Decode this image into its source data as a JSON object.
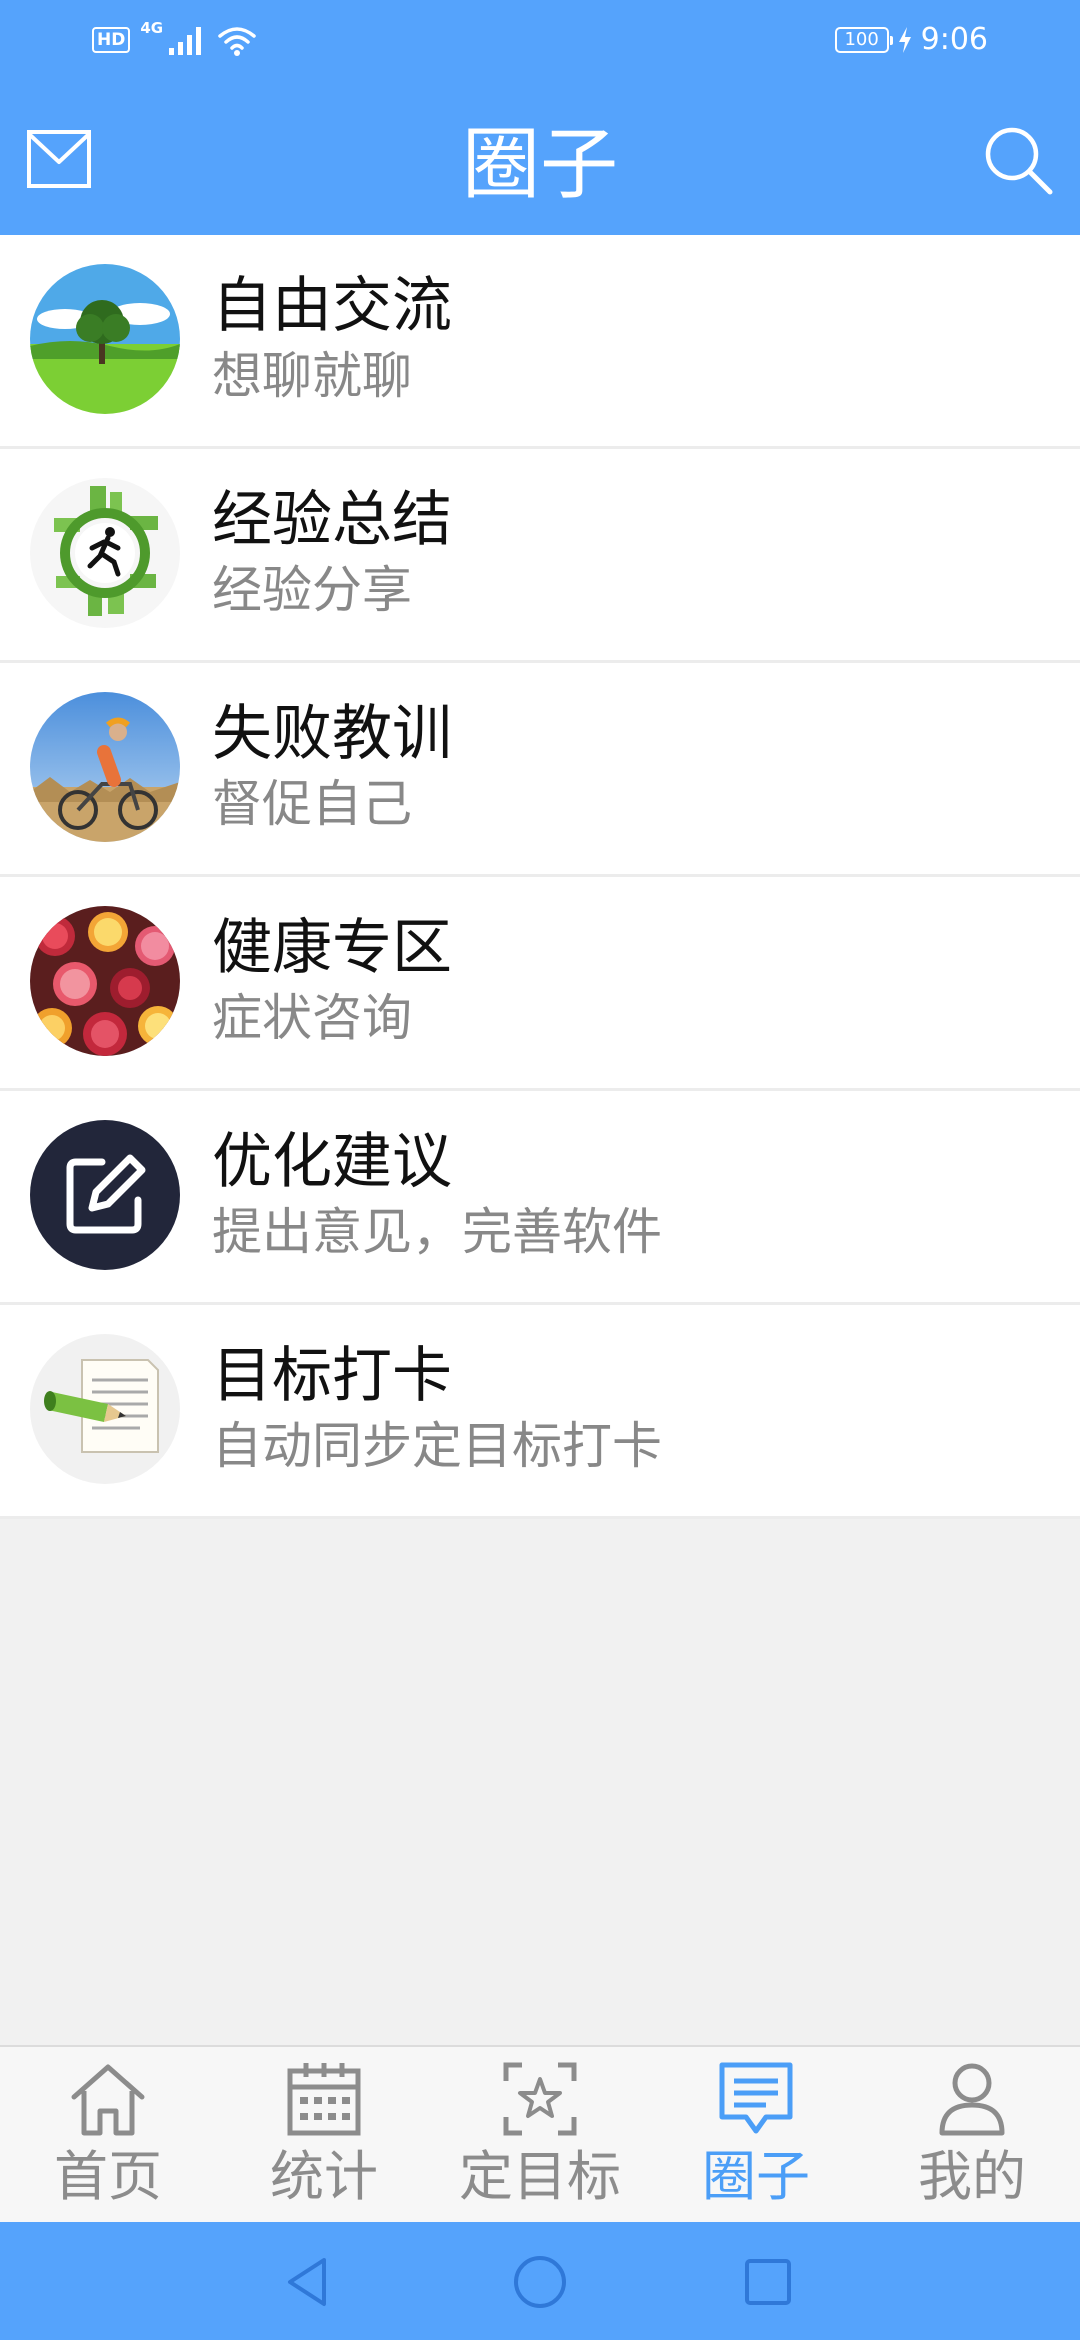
{
  "status_bar": {
    "hd": "HD",
    "network": "4G",
    "battery": "100",
    "time": "9:06"
  },
  "header": {
    "title": "圈子",
    "mail_icon": "mail-icon",
    "search_icon": "search-icon"
  },
  "circles": [
    {
      "title": "自由交流",
      "subtitle": "想聊就聊",
      "icon": "tree-meadow-avatar"
    },
    {
      "title": "经验总结",
      "subtitle": "经验分享",
      "icon": "runner-city-avatar"
    },
    {
      "title": "失败教训",
      "subtitle": "督促自己",
      "icon": "cyclist-avatar"
    },
    {
      "title": "健康专区",
      "subtitle": "症状咨询",
      "icon": "fruits-avatar"
    },
    {
      "title": "优化建议",
      "subtitle": "提出意见，完善软件",
      "icon": "edit-note-avatar"
    },
    {
      "title": "目标打卡",
      "subtitle": "自动同步定目标打卡",
      "icon": "pencil-paper-avatar"
    }
  ],
  "tabs": [
    {
      "label": "首页",
      "icon": "home-icon",
      "active": false
    },
    {
      "label": "统计",
      "icon": "calendar-icon",
      "active": false
    },
    {
      "label": "定目标",
      "icon": "star-target-icon",
      "active": false
    },
    {
      "label": "圈子",
      "icon": "chat-bubble-icon",
      "active": true
    },
    {
      "label": "我的",
      "icon": "user-icon",
      "active": false
    }
  ],
  "nav_bar": [
    "back-triangle-icon",
    "home-circle-icon",
    "recents-square-icon"
  ],
  "colors": {
    "primary": "#55a3fc",
    "active_tab": "#4b9ef7",
    "inactive_tab": "#8c8c8c",
    "subtitle": "#888888"
  }
}
